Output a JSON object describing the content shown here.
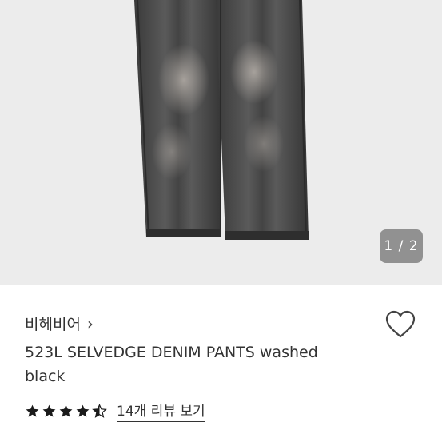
{
  "gallery": {
    "image_alt": "washed black denim pants",
    "page_counter": "1 / 2"
  },
  "product": {
    "brand": "비헤비어",
    "brand_chevron": "›",
    "title": "523L SELVEDGE DENIM PANTS washed black",
    "rating": 4.5,
    "review_link": "14개 리뷰 보기"
  },
  "icons": {
    "wishlist": "heart-outline-icon",
    "star": "star-icon"
  },
  "colors": {
    "star": "#1a1a1a",
    "gallery_bg": "#ececec"
  }
}
